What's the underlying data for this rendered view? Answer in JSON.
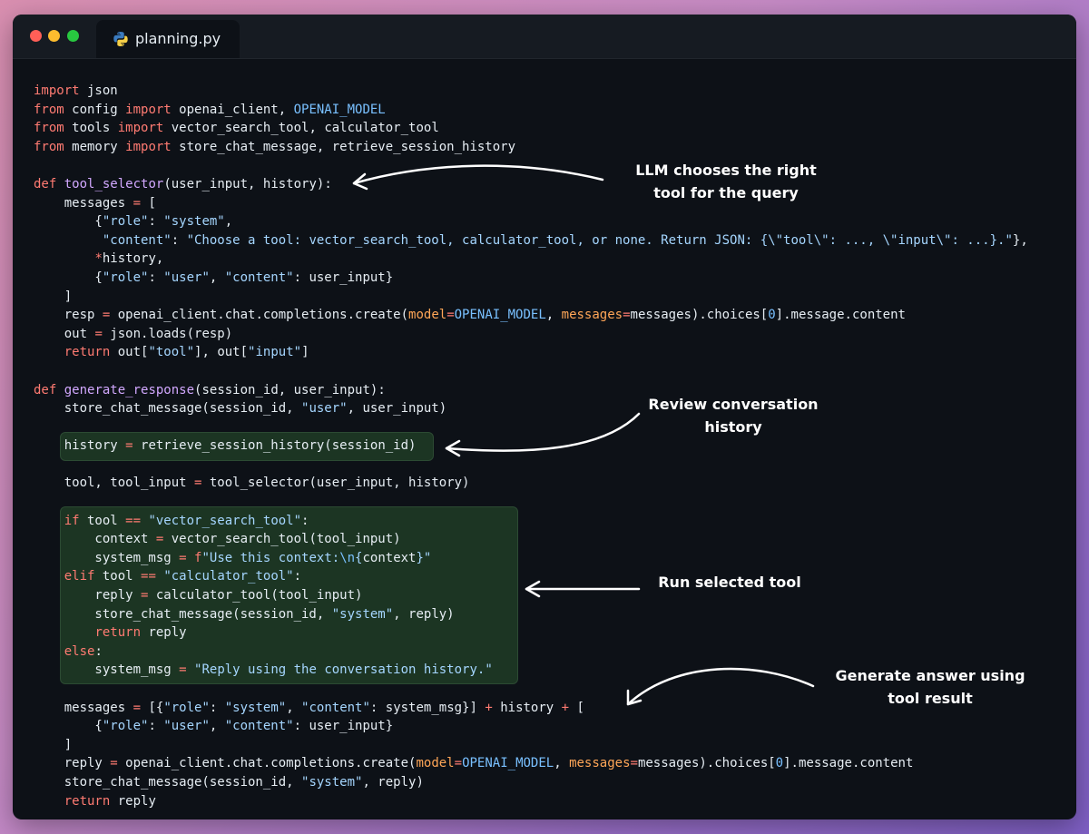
{
  "window": {
    "tab_label": "planning.py",
    "tab_icon": "python-icon"
  },
  "code_lines": [
    [
      [
        "kw",
        "import"
      ],
      [
        "p",
        " json"
      ]
    ],
    [
      [
        "kw",
        "from"
      ],
      [
        "p",
        " config "
      ],
      [
        "kw",
        "import"
      ],
      [
        "p",
        " openai_client, "
      ],
      [
        "cn",
        "OPENAI_MODEL"
      ]
    ],
    [
      [
        "kw",
        "from"
      ],
      [
        "p",
        " tools "
      ],
      [
        "kw",
        "import"
      ],
      [
        "p",
        " vector_search_tool, calculator_tool"
      ]
    ],
    [
      [
        "kw",
        "from"
      ],
      [
        "p",
        " memory "
      ],
      [
        "kw",
        "import"
      ],
      [
        "p",
        " store_chat_message, retrieve_session_history"
      ]
    ],
    [],
    [
      [
        "kw",
        "def"
      ],
      [
        "p",
        " "
      ],
      [
        "fn",
        "tool_selector"
      ],
      [
        "p",
        "(user_input, history):"
      ]
    ],
    [
      [
        "p",
        "    messages "
      ],
      [
        "kw",
        "="
      ],
      [
        "p",
        " ["
      ]
    ],
    [
      [
        "p",
        "        {"
      ],
      [
        "st",
        "\"role\""
      ],
      [
        "p",
        ": "
      ],
      [
        "st",
        "\"system\""
      ],
      [
        "p",
        ","
      ]
    ],
    [
      [
        "p",
        "         "
      ],
      [
        "st",
        "\"content\""
      ],
      [
        "p",
        ": "
      ],
      [
        "st",
        "\"Choose a tool: vector_search_tool, calculator_tool, or none. Return JSON: {\\\"tool\\\": ..., \\\"input\\\": ...}.\""
      ],
      [
        "p",
        "},"
      ]
    ],
    [
      [
        "p",
        "        "
      ],
      [
        "kw",
        "*"
      ],
      [
        "p",
        "history,"
      ]
    ],
    [
      [
        "p",
        "        {"
      ],
      [
        "st",
        "\"role\""
      ],
      [
        "p",
        ": "
      ],
      [
        "st",
        "\"user\""
      ],
      [
        "p",
        ", "
      ],
      [
        "st",
        "\"content\""
      ],
      [
        "p",
        ": user_input}"
      ]
    ],
    [
      [
        "p",
        "    ]"
      ]
    ],
    [
      [
        "p",
        "    resp "
      ],
      [
        "kw",
        "="
      ],
      [
        "p",
        " openai_client.chat.completions.create("
      ],
      [
        "pa",
        "model"
      ],
      [
        "kw",
        "="
      ],
      [
        "cn",
        "OPENAI_MODEL"
      ],
      [
        "p",
        ", "
      ],
      [
        "pa",
        "messages"
      ],
      [
        "kw",
        "="
      ],
      [
        "p",
        "messages).choices["
      ],
      [
        "cn",
        "0"
      ],
      [
        "p",
        "].message.content"
      ]
    ],
    [
      [
        "p",
        "    out "
      ],
      [
        "kw",
        "="
      ],
      [
        "p",
        " json.loads(resp)"
      ]
    ],
    [
      [
        "p",
        "    "
      ],
      [
        "kw",
        "return"
      ],
      [
        "p",
        " out["
      ],
      [
        "st",
        "\"tool\""
      ],
      [
        "p",
        "], out["
      ],
      [
        "st",
        "\"input\""
      ],
      [
        "p",
        "]"
      ]
    ],
    [],
    [
      [
        "kw",
        "def"
      ],
      [
        "p",
        " "
      ],
      [
        "fn",
        "generate_response"
      ],
      [
        "p",
        "(session_id, user_input):"
      ]
    ],
    [
      [
        "p",
        "    store_chat_message(session_id, "
      ],
      [
        "st",
        "\"user\""
      ],
      [
        "p",
        ", user_input)"
      ]
    ],
    [],
    [
      [
        "p",
        "    history "
      ],
      [
        "kw",
        "="
      ],
      [
        "p",
        " retrieve_session_history(session_id)"
      ]
    ],
    [],
    [
      [
        "p",
        "    tool, tool_input "
      ],
      [
        "kw",
        "="
      ],
      [
        "p",
        " tool_selector(user_input, history)"
      ]
    ],
    [],
    [
      [
        "p",
        "    "
      ],
      [
        "kw",
        "if"
      ],
      [
        "p",
        " tool "
      ],
      [
        "kw",
        "=="
      ],
      [
        "p",
        " "
      ],
      [
        "st",
        "\"vector_search_tool\""
      ],
      [
        "p",
        ":"
      ]
    ],
    [
      [
        "p",
        "        context "
      ],
      [
        "kw",
        "="
      ],
      [
        "p",
        " vector_search_tool(tool_input)"
      ]
    ],
    [
      [
        "p",
        "        system_msg "
      ],
      [
        "kw",
        "="
      ],
      [
        "p",
        " "
      ],
      [
        "kw",
        "f"
      ],
      [
        "st",
        "\"Use this context:"
      ],
      [
        "cn",
        "\\n"
      ],
      [
        "st",
        "{"
      ],
      [
        "p",
        "context"
      ],
      [
        "st",
        "}\""
      ]
    ],
    [
      [
        "p",
        "    "
      ],
      [
        "kw",
        "elif"
      ],
      [
        "p",
        " tool "
      ],
      [
        "kw",
        "=="
      ],
      [
        "p",
        " "
      ],
      [
        "st",
        "\"calculator_tool\""
      ],
      [
        "p",
        ":"
      ]
    ],
    [
      [
        "p",
        "        reply "
      ],
      [
        "kw",
        "="
      ],
      [
        "p",
        " calculator_tool(tool_input)"
      ]
    ],
    [
      [
        "p",
        "        store_chat_message(session_id, "
      ],
      [
        "st",
        "\"system\""
      ],
      [
        "p",
        ", reply)"
      ]
    ],
    [
      [
        "p",
        "        "
      ],
      [
        "kw",
        "return"
      ],
      [
        "p",
        " reply"
      ]
    ],
    [
      [
        "p",
        "    "
      ],
      [
        "kw",
        "else"
      ],
      [
        "p",
        ":"
      ]
    ],
    [
      [
        "p",
        "        system_msg "
      ],
      [
        "kw",
        "="
      ],
      [
        "p",
        " "
      ],
      [
        "st",
        "\"Reply using the conversation history.\""
      ]
    ],
    [],
    [
      [
        "p",
        "    messages "
      ],
      [
        "kw",
        "="
      ],
      [
        "p",
        " [{"
      ],
      [
        "st",
        "\"role\""
      ],
      [
        "p",
        ": "
      ],
      [
        "st",
        "\"system\""
      ],
      [
        "p",
        ", "
      ],
      [
        "st",
        "\"content\""
      ],
      [
        "p",
        ": system_msg}] "
      ],
      [
        "kw",
        "+"
      ],
      [
        "p",
        " history "
      ],
      [
        "kw",
        "+"
      ],
      [
        "p",
        " ["
      ]
    ],
    [
      [
        "p",
        "        {"
      ],
      [
        "st",
        "\"role\""
      ],
      [
        "p",
        ": "
      ],
      [
        "st",
        "\"user\""
      ],
      [
        "p",
        ", "
      ],
      [
        "st",
        "\"content\""
      ],
      [
        "p",
        ": user_input}"
      ]
    ],
    [
      [
        "p",
        "    ]"
      ]
    ],
    [
      [
        "p",
        "    reply "
      ],
      [
        "kw",
        "="
      ],
      [
        "p",
        " openai_client.chat.completions.create("
      ],
      [
        "pa",
        "model"
      ],
      [
        "kw",
        "="
      ],
      [
        "cn",
        "OPENAI_MODEL"
      ],
      [
        "p",
        ", "
      ],
      [
        "pa",
        "messages"
      ],
      [
        "kw",
        "="
      ],
      [
        "p",
        "messages).choices["
      ],
      [
        "cn",
        "0"
      ],
      [
        "p",
        "].message.content"
      ]
    ],
    [
      [
        "p",
        "    store_chat_message(session_id, "
      ],
      [
        "st",
        "\"system\""
      ],
      [
        "p",
        ", reply)"
      ]
    ],
    [
      [
        "p",
        "    "
      ],
      [
        "kw",
        "return"
      ],
      [
        "p",
        " reply"
      ]
    ]
  ],
  "annotations": {
    "llm": {
      "line1": "LLM chooses the right",
      "line2": "tool for the query"
    },
    "history": {
      "line1": "Review conversation",
      "line2": "history"
    },
    "tool": {
      "line1": "Run selected tool"
    },
    "answer": {
      "line1": "Generate answer using",
      "line2": "tool result"
    }
  },
  "colors": {
    "background_gradient": [
      "#d98fb0",
      "#7e5fc4"
    ],
    "editor_bg": "#0d1117",
    "keyword": "#ff7b72",
    "function": "#d2a8ff",
    "constant": "#79c0ff",
    "string": "#a5d6ff",
    "param": "#ffa657",
    "highlight_bg": "#1c3523"
  }
}
